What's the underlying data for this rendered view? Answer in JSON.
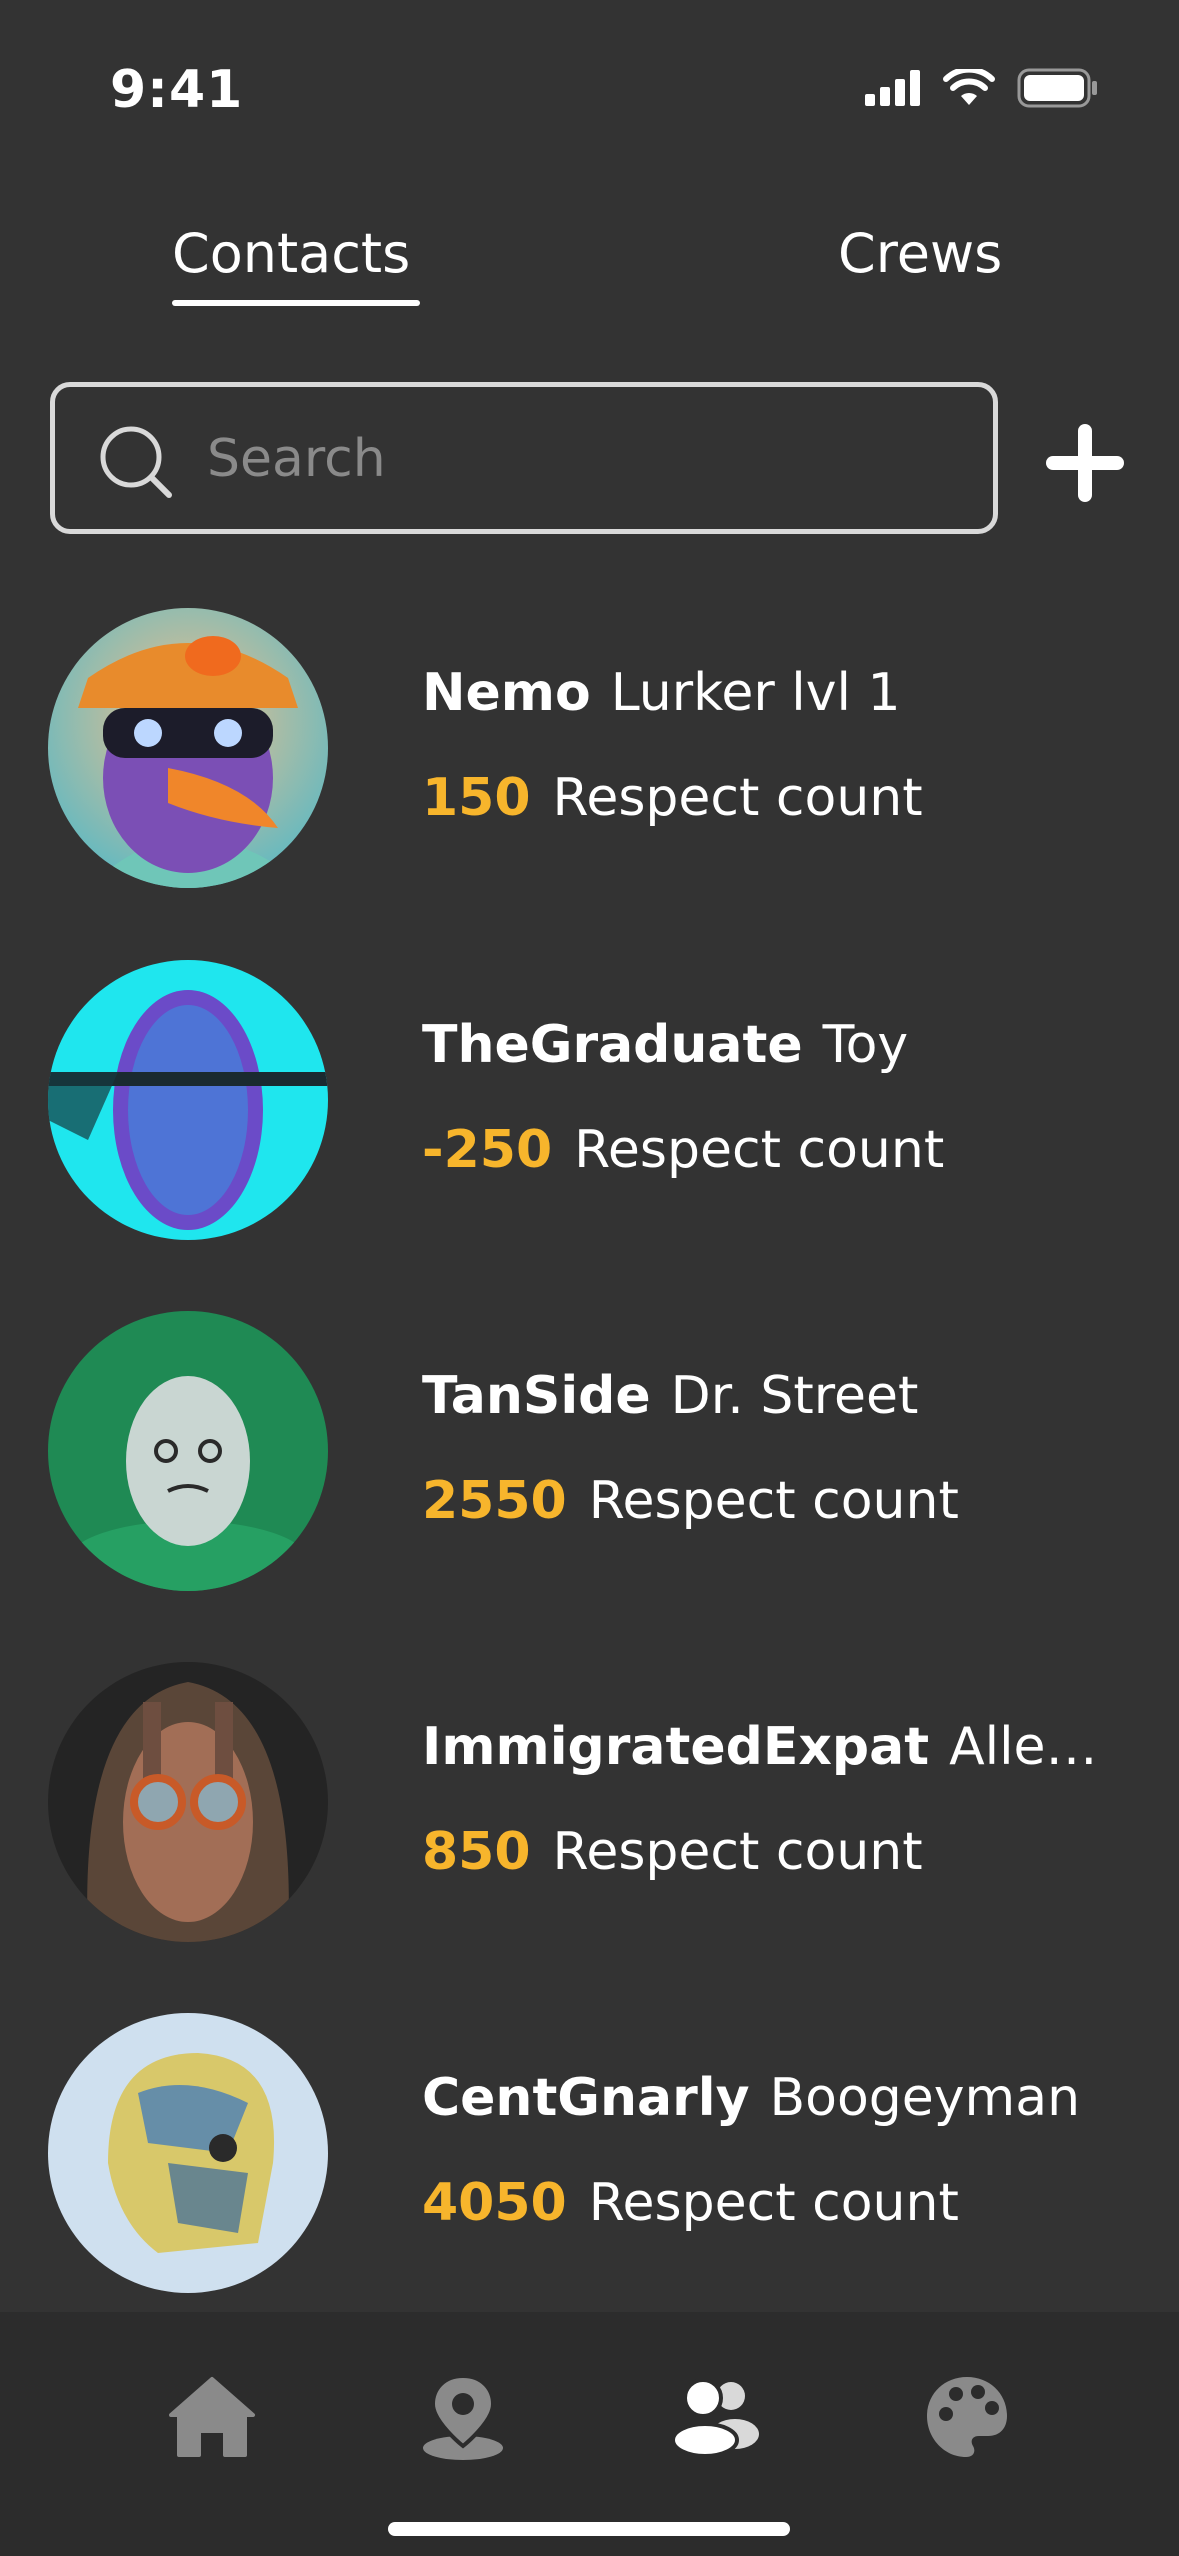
{
  "status_bar": {
    "time": "9:41"
  },
  "tabs": [
    {
      "label": "Contacts",
      "active": true
    },
    {
      "label": "Crews",
      "active": false
    }
  ],
  "search": {
    "placeholder": "Search",
    "value": ""
  },
  "contacts": [
    {
      "name": "Nemo",
      "role": "Lurker lvl 1",
      "respect": "150",
      "respect_label": "Respect count",
      "avatar": "parrot-avatar"
    },
    {
      "name": "TheGraduate",
      "role": "Toy",
      "respect": "-250",
      "respect_label": "Respect count",
      "avatar": "tangled-head-avatar"
    },
    {
      "name": "TanSide",
      "role": "Dr. Street",
      "respect": "2550",
      "respect_label": "Respect count",
      "avatar": "egg-avatar"
    },
    {
      "name": "ImmigratedExpat",
      "role": "Alley...",
      "respect": "850",
      "respect_label": "Respect count",
      "avatar": "hooded-goggles-avatar"
    },
    {
      "name": "CentGnarly",
      "role": "Boogeyman",
      "respect": "4050",
      "respect_label": "Respect count",
      "avatar": "painted-skull-avatar"
    }
  ],
  "bottom_nav": [
    {
      "icon": "home-icon",
      "active": false
    },
    {
      "icon": "location-icon",
      "active": false
    },
    {
      "icon": "contacts-icon",
      "active": true
    },
    {
      "icon": "palette-icon",
      "active": false
    }
  ],
  "colors": {
    "background": "#333333",
    "accent": "#f7b52c",
    "nav_background": "#2c2c2c",
    "nav_inactive": "#8a8a8a"
  }
}
